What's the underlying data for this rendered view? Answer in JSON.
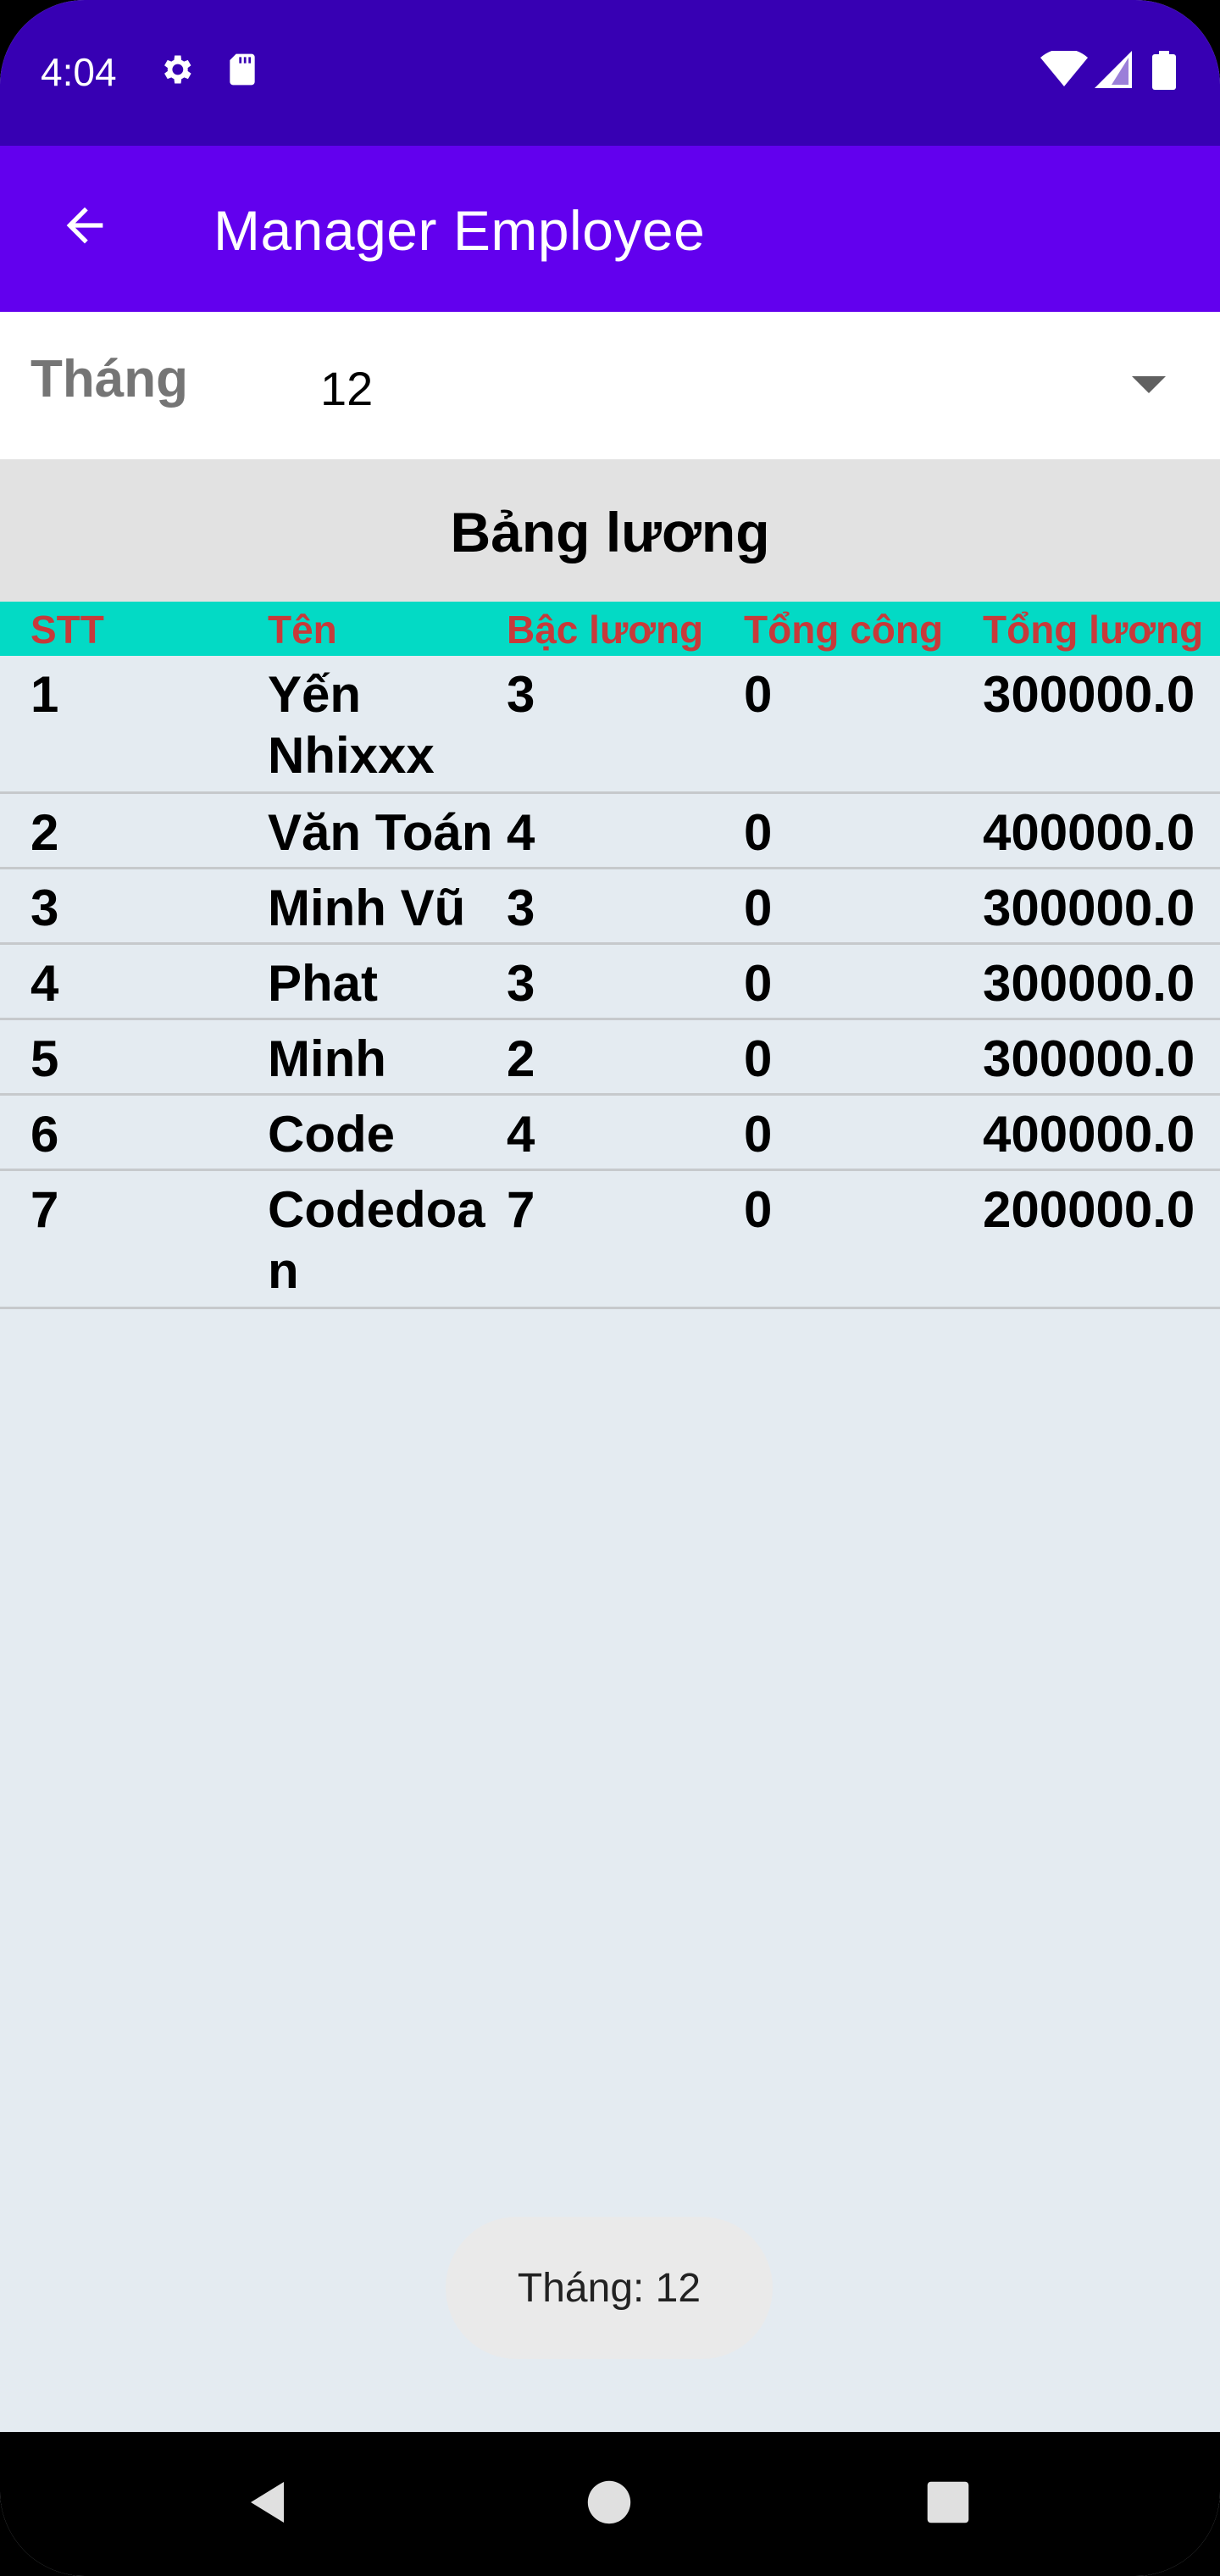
{
  "status_bar": {
    "time": "4:04",
    "icons": [
      "settings-icon",
      "sd-card-icon",
      "wifi-icon",
      "signal-icon",
      "battery-icon"
    ]
  },
  "app_bar": {
    "title": "Manager Employee",
    "back_icon": "arrow-back-icon",
    "color": "#6200EE",
    "status_color": "#3700B3"
  },
  "month_selector": {
    "label": "Tháng",
    "selected": "12"
  },
  "table": {
    "title": "Bảng lương",
    "header_color": "#03DAC5",
    "header_text_color": "#C73A3A",
    "columns": [
      "STT",
      "Tên",
      "Bậc lương",
      "Tổng công",
      "Tổng lương"
    ],
    "rows": [
      {
        "stt": "1",
        "ten": "Yến Nhixxx",
        "bac": "3",
        "cong": "0",
        "luong": "300000.0"
      },
      {
        "stt": "2",
        "ten": "Văn Toán",
        "bac": "4",
        "cong": "0",
        "luong": "400000.0"
      },
      {
        "stt": "3",
        "ten": "Minh Vũ",
        "bac": "3",
        "cong": "0",
        "luong": "300000.0"
      },
      {
        "stt": "4",
        "ten": "Phat",
        "bac": "3",
        "cong": "0",
        "luong": "300000.0"
      },
      {
        "stt": "5",
        "ten": "Minh",
        "bac": "2",
        "cong": "0",
        "luong": "300000.0"
      },
      {
        "stt": "6",
        "ten": "Code",
        "bac": "4",
        "cong": "0",
        "luong": "400000.0"
      },
      {
        "stt": "7",
        "ten": "Codedoa n",
        "bac": "7",
        "cong": "0",
        "luong": "200000.0"
      }
    ]
  },
  "toast": {
    "text": "Tháng: 12"
  },
  "nav_bar": {
    "icons": [
      "back-triangle-icon",
      "home-circle-icon",
      "recents-square-icon"
    ]
  }
}
